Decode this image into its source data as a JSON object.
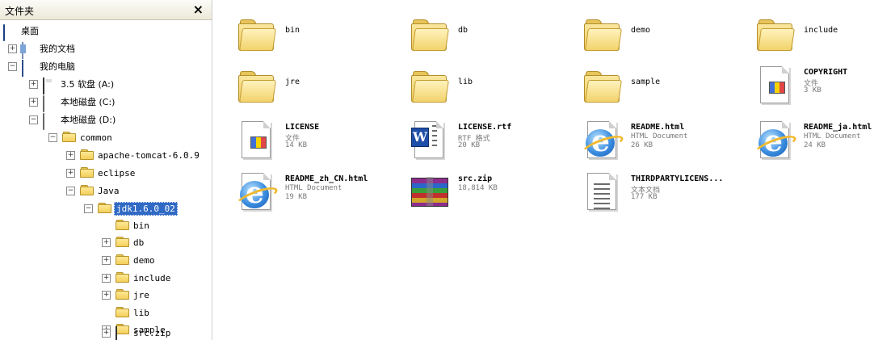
{
  "folders_pane": {
    "title": "文件夹",
    "close_symbol": "×",
    "tree": [
      {
        "label": "桌面",
        "icon": "desktop-icon",
        "expander": "",
        "level": 0
      },
      {
        "label": "我的文档",
        "icon": "my-documents-icon",
        "expander": "+",
        "level": 1
      },
      {
        "label": "我的电脑",
        "icon": "my-computer-icon",
        "expander": "−",
        "level": 1
      },
      {
        "label": "3.5 软盘 (A:)",
        "icon": "floppy-icon",
        "expander": "+",
        "level": 2
      },
      {
        "label": "本地磁盘 (C:)",
        "icon": "drive-icon",
        "expander": "+",
        "level": 2
      },
      {
        "label": "本地磁盘 (D:)",
        "icon": "drive-icon",
        "expander": "−",
        "level": 2
      },
      {
        "label": "common",
        "icon": "folder-icon",
        "expander": "−",
        "level": 3
      },
      {
        "label": "apache-tomcat-6.0.9",
        "icon": "folder-icon",
        "expander": "+",
        "level": 4
      },
      {
        "label": "eclipse",
        "icon": "folder-icon",
        "expander": "+",
        "level": 4
      },
      {
        "label": "Java",
        "icon": "folder-icon",
        "expander": "−",
        "level": 4
      },
      {
        "label": "jdk1.6.0_02",
        "icon": "folder-open-icon",
        "expander": "−",
        "level": 5,
        "selected": true
      },
      {
        "label": "bin",
        "icon": "folder-icon",
        "expander": "",
        "level": 6
      },
      {
        "label": "db",
        "icon": "folder-icon",
        "expander": "+",
        "level": 6
      },
      {
        "label": "demo",
        "icon": "folder-icon",
        "expander": "+",
        "level": 6
      },
      {
        "label": "include",
        "icon": "folder-icon",
        "expander": "+",
        "level": 6
      },
      {
        "label": "jre",
        "icon": "folder-icon",
        "expander": "+",
        "level": 6
      },
      {
        "label": "lib",
        "icon": "folder-icon",
        "expander": "",
        "level": 6
      },
      {
        "label": "sample",
        "icon": "folder-icon",
        "expander": "+",
        "level": 6
      },
      {
        "label": "src.zip",
        "icon": "zip-archive-icon",
        "expander": "+",
        "level": 6
      }
    ]
  },
  "items": [
    {
      "name": "bin",
      "kind": "folder",
      "icon": "folder-icon"
    },
    {
      "name": "db",
      "kind": "folder",
      "icon": "folder-icon"
    },
    {
      "name": "demo",
      "kind": "folder",
      "icon": "folder-icon"
    },
    {
      "name": "include",
      "kind": "folder",
      "icon": "folder-icon"
    },
    {
      "name": "jre",
      "kind": "folder",
      "icon": "folder-icon"
    },
    {
      "name": "lib",
      "kind": "folder",
      "icon": "folder-icon"
    },
    {
      "name": "sample",
      "kind": "folder",
      "icon": "folder-icon"
    },
    {
      "name": "COPYRIGHT",
      "type": "文件",
      "size": "3 KB",
      "icon": "system-file-icon"
    },
    {
      "name": "LICENSE",
      "type": "文件",
      "size": "14 KB",
      "icon": "system-file-icon"
    },
    {
      "name": "LICENSE.rtf",
      "type": "RTF 格式",
      "size": "20 KB",
      "icon": "word-document-icon"
    },
    {
      "name": "README.html",
      "type": "HTML Document",
      "size": "26 KB",
      "icon": "ie-html-icon"
    },
    {
      "name": "README_ja.html",
      "type": "HTML Document",
      "size": "24 KB",
      "icon": "ie-html-icon"
    },
    {
      "name": "README_zh_CN.html",
      "type": "HTML Document",
      "size": "19 KB",
      "icon": "ie-html-icon"
    },
    {
      "name": "src.zip",
      "type": "",
      "size": "18,814 KB",
      "icon": "winrar-archive-icon"
    },
    {
      "name": "THIRDPARTYLICENS...",
      "type": "文本文档",
      "size": "177 KB",
      "icon": "text-document-icon"
    }
  ]
}
